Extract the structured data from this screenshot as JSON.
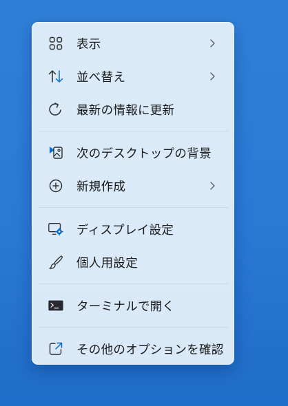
{
  "menu": {
    "items": [
      {
        "label": "表示",
        "icon": "view-grid-icon",
        "submenu": true
      },
      {
        "label": "並べ替え",
        "icon": "sort-arrows-icon",
        "submenu": true
      },
      {
        "label": "最新の情報に更新",
        "icon": "refresh-icon",
        "submenu": false
      },
      {
        "label": "次のデスクトップの背景",
        "icon": "next-background-icon",
        "submenu": false
      },
      {
        "label": "新規作成",
        "icon": "new-plus-icon",
        "submenu": true
      },
      {
        "label": "ディスプレイ設定",
        "icon": "display-settings-icon",
        "submenu": false
      },
      {
        "label": "個人用設定",
        "icon": "personalize-brush-icon",
        "submenu": false
      },
      {
        "label": "ターミナルで開く",
        "icon": "terminal-icon",
        "submenu": false
      },
      {
        "label": "その他のオプションを確認",
        "icon": "more-options-icon",
        "submenu": false
      }
    ]
  },
  "colors": {
    "desktop": "#2a79d4",
    "menu_background": "#e2eefa",
    "accent": "#0a6cd0",
    "text": "#1b1b1b",
    "separator": "#c9d5e1"
  }
}
